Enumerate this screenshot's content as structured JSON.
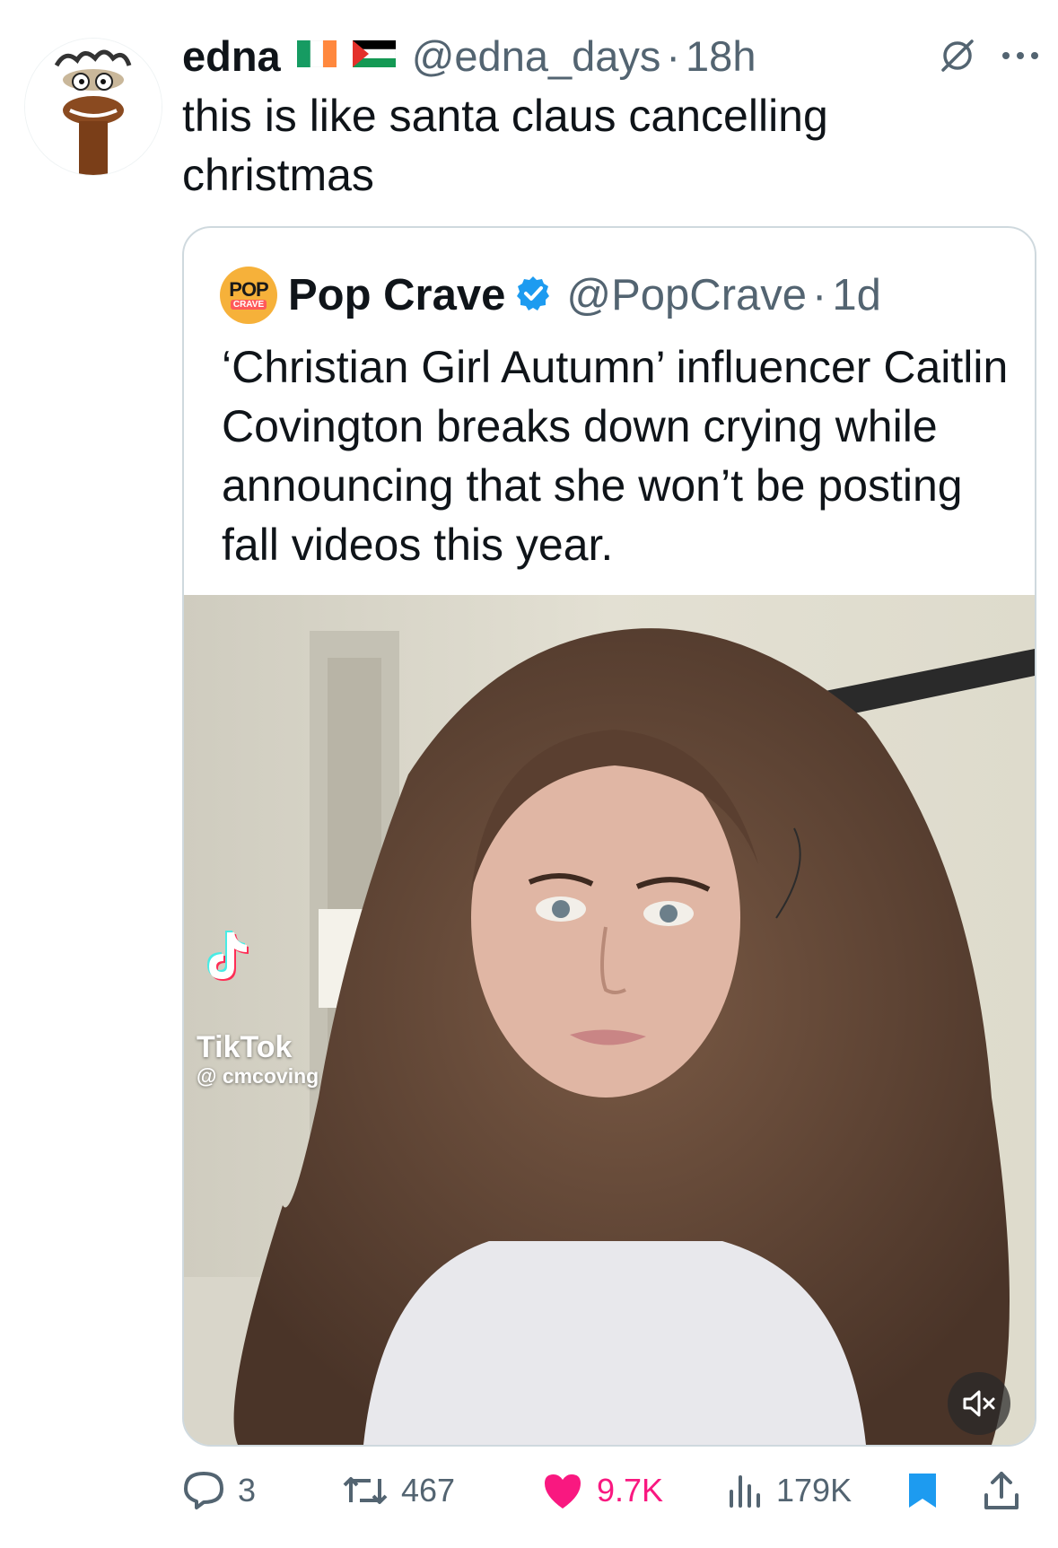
{
  "tweet": {
    "display_name": "edna",
    "handle": "@edna_days",
    "separator": "·",
    "time": "18h",
    "text": "this is like santa claus cancelling christmas",
    "flags": [
      "flag-ireland-icon",
      "flag-palestine-icon"
    ]
  },
  "quoted": {
    "logo_top": "POP",
    "logo_bottom": "CRAVE",
    "display_name": "Pop Crave",
    "handle": "@PopCrave",
    "separator": "·",
    "time": "1d",
    "text": "‘Christian Girl Autumn’ influencer Caitlin Covington breaks down crying while announcing that she won’t be posting fall videos this year.",
    "media": {
      "watermark_brand": "TikTok",
      "watermark_user": "@ cmcoving"
    }
  },
  "actions": {
    "replies": "3",
    "retweets": "467",
    "likes": "9.7K",
    "views": "179K"
  },
  "colors": {
    "text": "#0f1419",
    "secondary": "#536471",
    "like": "#f91880",
    "accent": "#1d9bf0",
    "border": "#cfd9de"
  }
}
